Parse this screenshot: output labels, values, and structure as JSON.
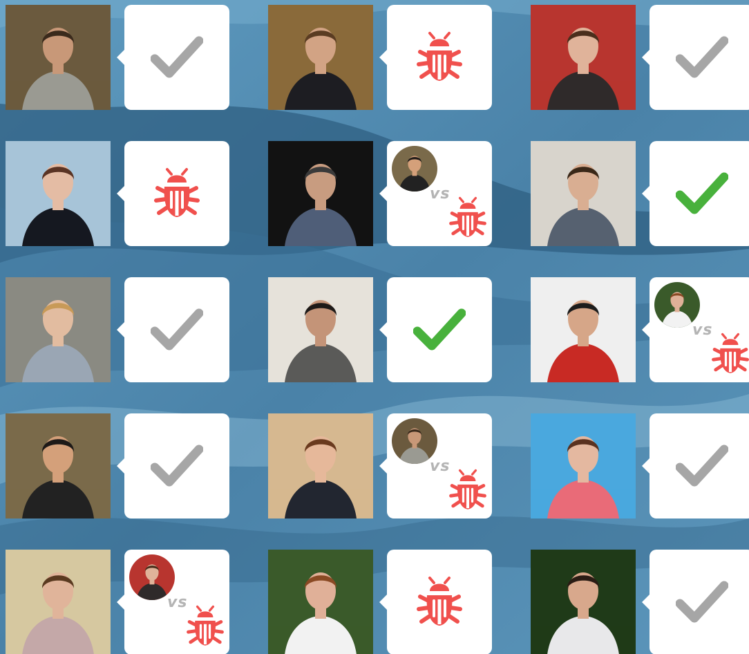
{
  "theme": {
    "pass_gray": "#a6a6a6",
    "pass_green": "#48b13c",
    "bug_red": "#f0504d",
    "vs_gray": "#b4b4b4"
  },
  "vs_text": "vs",
  "cells": [
    {
      "row": 1,
      "col": 1,
      "result": "pass",
      "state": "inactive",
      "icon": "check-icon"
    },
    {
      "row": 1,
      "col": 2,
      "result": "bug",
      "icon": "bug-icon"
    },
    {
      "row": 1,
      "col": 3,
      "result": "pass",
      "state": "inactive",
      "icon": "check-icon"
    },
    {
      "row": 2,
      "col": 1,
      "result": "bug",
      "icon": "bug-icon"
    },
    {
      "row": 2,
      "col": 2,
      "result": "versus",
      "icon": "bug-icon",
      "vs": "vs"
    },
    {
      "row": 2,
      "col": 3,
      "result": "pass",
      "state": "active",
      "icon": "check-icon"
    },
    {
      "row": 3,
      "col": 1,
      "result": "pass",
      "state": "inactive",
      "icon": "check-icon"
    },
    {
      "row": 3,
      "col": 2,
      "result": "pass",
      "state": "active",
      "icon": "check-icon"
    },
    {
      "row": 3,
      "col": 3,
      "result": "versus",
      "icon": "bug-icon",
      "vs": "vs"
    },
    {
      "row": 4,
      "col": 1,
      "result": "pass",
      "state": "inactive",
      "icon": "check-icon"
    },
    {
      "row": 4,
      "col": 2,
      "result": "versus",
      "icon": "bug-icon",
      "vs": "vs"
    },
    {
      "row": 4,
      "col": 3,
      "result": "pass",
      "state": "inactive",
      "icon": "check-icon"
    },
    {
      "row": 5,
      "col": 1,
      "result": "versus",
      "icon": "bug-icon",
      "vs": "vs"
    },
    {
      "row": 5,
      "col": 2,
      "result": "bug",
      "icon": "bug-icon"
    },
    {
      "row": 5,
      "col": 3,
      "result": "pass",
      "state": "inactive",
      "icon": "check-icon"
    }
  ]
}
